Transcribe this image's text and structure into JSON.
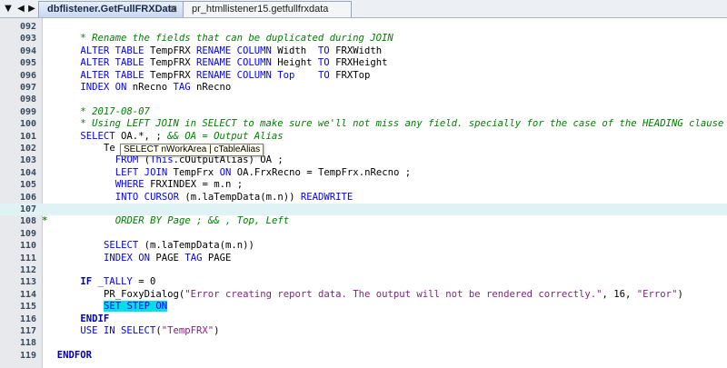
{
  "tabs": [
    {
      "label": "dbflistener.GetFullFRXData",
      "active": true,
      "close_glyph": "⊠"
    },
    {
      "label": "pr_htmllistener15.getfullfrxdata",
      "active": false
    }
  ],
  "nav": {
    "down_glyph": "▼",
    "left_glyph": "◀",
    "right_glyph": "▶"
  },
  "tooltip": "SELECT nWorkArea | cTableAlias",
  "colors": {
    "keyword": "#0000ff",
    "comment": "#008000",
    "string": "#7f1f7f",
    "current_line": "#dff3f5",
    "highlight": "#00e0e8"
  },
  "lines": [
    {
      "num": "092",
      "indent": 0,
      "parts": []
    },
    {
      "num": "093",
      "indent": 6,
      "parts": [
        {
          "t": "cm",
          "v": "* Rename the fields that can be duplicated during JOIN"
        }
      ]
    },
    {
      "num": "094",
      "indent": 6,
      "parts": [
        {
          "t": "kw",
          "v": "ALTER TABLE"
        },
        {
          "t": "",
          "v": " TempFRX "
        },
        {
          "t": "kw",
          "v": "RENAME COLUMN"
        },
        {
          "t": "",
          "v": " Width  "
        },
        {
          "t": "kw",
          "v": "TO"
        },
        {
          "t": "",
          "v": " FRXWidth"
        }
      ]
    },
    {
      "num": "095",
      "indent": 6,
      "parts": [
        {
          "t": "kw",
          "v": "ALTER TABLE"
        },
        {
          "t": "",
          "v": " TempFRX "
        },
        {
          "t": "kw",
          "v": "RENAME COLUMN"
        },
        {
          "t": "",
          "v": " Height "
        },
        {
          "t": "kw",
          "v": "TO"
        },
        {
          "t": "",
          "v": " FRXHeight"
        }
      ]
    },
    {
      "num": "096",
      "indent": 6,
      "parts": [
        {
          "t": "kw",
          "v": "ALTER TABLE"
        },
        {
          "t": "",
          "v": " TempFRX "
        },
        {
          "t": "kw",
          "v": "RENAME COLUMN"
        },
        {
          "t": "",
          "v": " "
        },
        {
          "t": "kw",
          "v": "Top"
        },
        {
          "t": "",
          "v": "    "
        },
        {
          "t": "kw",
          "v": "TO"
        },
        {
          "t": "",
          "v": " FRXTop"
        }
      ]
    },
    {
      "num": "097",
      "indent": 6,
      "parts": [
        {
          "t": "kw",
          "v": "INDEX ON"
        },
        {
          "t": "",
          "v": " nRecno "
        },
        {
          "t": "kw",
          "v": "TAG"
        },
        {
          "t": "",
          "v": " nRecno"
        }
      ]
    },
    {
      "num": "098",
      "indent": 0,
      "parts": []
    },
    {
      "num": "099",
      "indent": 6,
      "parts": [
        {
          "t": "cm",
          "v": "* 2017-08-07"
        }
      ]
    },
    {
      "num": "100",
      "indent": 6,
      "parts": [
        {
          "t": "cm",
          "v": "* Using LEFT JOIN in SELECT to make sure we'll not miss any field. specially for the case of the HEADING clause"
        }
      ]
    },
    {
      "num": "101",
      "indent": 6,
      "parts": [
        {
          "t": "kw",
          "v": "SELECT"
        },
        {
          "t": "",
          "v": " OA.*, ; "
        },
        {
          "t": "cm",
          "v": "&& OA = Output Alias"
        }
      ]
    },
    {
      "num": "102",
      "indent": 10,
      "parts": [
        {
          "t": "",
          "v": "Te"
        }
      ]
    },
    {
      "num": "103",
      "indent": 12,
      "parts": [
        {
          "t": "kw",
          "v": "FROM"
        },
        {
          "t": "",
          "v": " ("
        },
        {
          "t": "kw",
          "v": "This"
        },
        {
          "t": "",
          "v": ".cOutputAlias) OA ;"
        }
      ]
    },
    {
      "num": "104",
      "indent": 12,
      "parts": [
        {
          "t": "kw",
          "v": "LEFT JOIN"
        },
        {
          "t": "",
          "v": " TempFrx "
        },
        {
          "t": "kw",
          "v": "ON"
        },
        {
          "t": "",
          "v": " OA.FrxRecno = TempFrx.nRecno ;"
        }
      ]
    },
    {
      "num": "105",
      "indent": 12,
      "parts": [
        {
          "t": "kw",
          "v": "WHERE"
        },
        {
          "t": "",
          "v": " FRXINDEX = m.n ;"
        }
      ]
    },
    {
      "num": "106",
      "indent": 12,
      "parts": [
        {
          "t": "kw",
          "v": "INTO CURSOR"
        },
        {
          "t": "",
          "v": " (m.laTempData(m.n)) "
        },
        {
          "t": "kw",
          "v": "READWRITE"
        }
      ]
    },
    {
      "num": "107",
      "indent": 0,
      "current": true,
      "parts": []
    },
    {
      "num": "108",
      "indent": 12,
      "marker": "*",
      "parts": [
        {
          "t": "cm",
          "v": "ORDER BY Page ; && , Top, Left"
        }
      ]
    },
    {
      "num": "109",
      "indent": 0,
      "parts": []
    },
    {
      "num": "110",
      "indent": 10,
      "parts": [
        {
          "t": "kw",
          "v": "SELECT"
        },
        {
          "t": "",
          "v": " (m.laTempData(m.n))"
        }
      ]
    },
    {
      "num": "111",
      "indent": 10,
      "parts": [
        {
          "t": "kw",
          "v": "INDEX ON"
        },
        {
          "t": "",
          "v": " PAGE "
        },
        {
          "t": "kw",
          "v": "TAG"
        },
        {
          "t": "",
          "v": " PAGE"
        }
      ]
    },
    {
      "num": "112",
      "indent": 0,
      "parts": []
    },
    {
      "num": "113",
      "indent": 6,
      "parts": [
        {
          "t": "kwb",
          "v": "IF"
        },
        {
          "t": "",
          "v": " "
        },
        {
          "t": "kw",
          "v": "_TALLY"
        },
        {
          "t": "",
          "v": " = 0"
        }
      ]
    },
    {
      "num": "114",
      "indent": 10,
      "parts": [
        {
          "t": "",
          "v": "PR_FoxyDialog("
        },
        {
          "t": "str",
          "v": "\"Error creating report data. The output will not be rendered correctly.\""
        },
        {
          "t": "",
          "v": ", 16, "
        },
        {
          "t": "str",
          "v": "\"Error\""
        },
        {
          "t": "",
          "v": ")"
        }
      ]
    },
    {
      "num": "115",
      "indent": 10,
      "parts": [
        {
          "t": "hl",
          "v": "SET STEP ON"
        }
      ]
    },
    {
      "num": "116",
      "indent": 6,
      "parts": [
        {
          "t": "kwb",
          "v": "ENDIF"
        }
      ]
    },
    {
      "num": "117",
      "indent": 6,
      "parts": [
        {
          "t": "kw",
          "v": "USE IN SELECT"
        },
        {
          "t": "",
          "v": "("
        },
        {
          "t": "str",
          "v": "\"TempFRX\""
        },
        {
          "t": "",
          "v": ")"
        }
      ]
    },
    {
      "num": "118",
      "indent": 0,
      "parts": []
    },
    {
      "num": "119",
      "indent": 2,
      "parts": [
        {
          "t": "kwb",
          "v": "ENDFOR"
        }
      ]
    }
  ]
}
